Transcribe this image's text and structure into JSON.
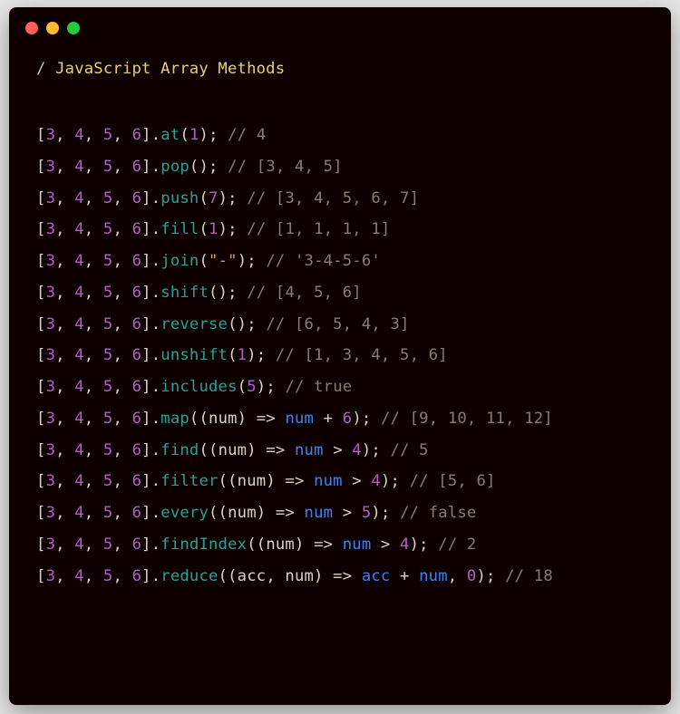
{
  "title": {
    "slash": "/",
    "text": "  JavaScript Array Methods"
  },
  "array": "[3, 4, 5, 6]",
  "lines": [
    {
      "method": "at",
      "args_plain": "1",
      "comment": "// 4"
    },
    {
      "method": "pop",
      "args_plain": "",
      "comment": "// [3, 4, 5]"
    },
    {
      "method": "push",
      "args_plain": "7",
      "comment": "// [3, 4, 5, 6, 7]"
    },
    {
      "method": "fill",
      "args_plain": "1",
      "comment": "// [1, 1, 1, 1]"
    },
    {
      "method": "join",
      "args_string": "\"-\"",
      "comment": "// '3-4-5-6'"
    },
    {
      "method": "shift",
      "args_plain": "",
      "comment": "// [4, 5, 6]"
    },
    {
      "method": "reverse",
      "args_plain": "",
      "comment": "// [6, 5, 4, 3]"
    },
    {
      "method": "unshift",
      "args_plain": "1",
      "comment": "// [1, 3, 4, 5, 6]"
    },
    {
      "method": "includes",
      "args_plain": "5",
      "comment": "// true"
    },
    {
      "method": "map",
      "callback": {
        "params": "(num)",
        "body_var": "num",
        "op": " + ",
        "rhs_num": "6"
      },
      "comment": "// [9, 10, 11, 12]"
    },
    {
      "method": "find",
      "callback": {
        "params": "(num)",
        "body_var": "num",
        "op": " > ",
        "rhs_num": "4"
      },
      "comment": "// 5"
    },
    {
      "method": "filter",
      "callback": {
        "params": "(num)",
        "body_var": "num",
        "op": " > ",
        "rhs_num": "4"
      },
      "comment": "// [5, 6]"
    },
    {
      "method": "every",
      "callback": {
        "params": "(num)",
        "body_var": "num",
        "op": " > ",
        "rhs_num": "5"
      },
      "comment": "// false"
    },
    {
      "method": "findIndex",
      "callback": {
        "params": "(num)",
        "body_var": "num",
        "op": " > ",
        "rhs_num": "4"
      },
      "comment": "// 2"
    },
    {
      "method": "reduce",
      "reduce": {
        "params": "(acc, num)",
        "var1": "acc",
        "op": " + ",
        "var2": "num",
        "init": "0"
      },
      "comment": "// 18"
    }
  ]
}
